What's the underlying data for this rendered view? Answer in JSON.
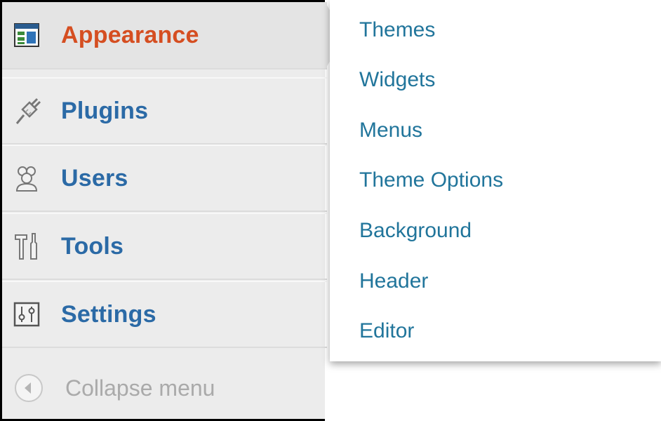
{
  "sidebar": {
    "items": [
      {
        "label": "Appearance",
        "icon": "appearance-icon",
        "current": true
      },
      {
        "label": "Plugins",
        "icon": "plugin-icon"
      },
      {
        "label": "Users",
        "icon": "users-icon"
      },
      {
        "label": "Tools",
        "icon": "tools-icon"
      },
      {
        "label": "Settings",
        "icon": "settings-icon"
      }
    ],
    "collapse": {
      "label": "Collapse menu",
      "icon": "collapse-arrow-icon"
    }
  },
  "submenu": {
    "items": [
      {
        "label": "Themes"
      },
      {
        "label": "Widgets"
      },
      {
        "label": "Menus"
      },
      {
        "label": "Theme Options"
      },
      {
        "label": "Background"
      },
      {
        "label": "Header"
      },
      {
        "label": "Editor"
      }
    ]
  },
  "colors": {
    "current_label": "#d54e21",
    "menu_label": "#2b6aa6",
    "submenu_link": "#21759b",
    "collapse_text": "#aaaaaa",
    "sidebar_bg": "#ececec"
  }
}
